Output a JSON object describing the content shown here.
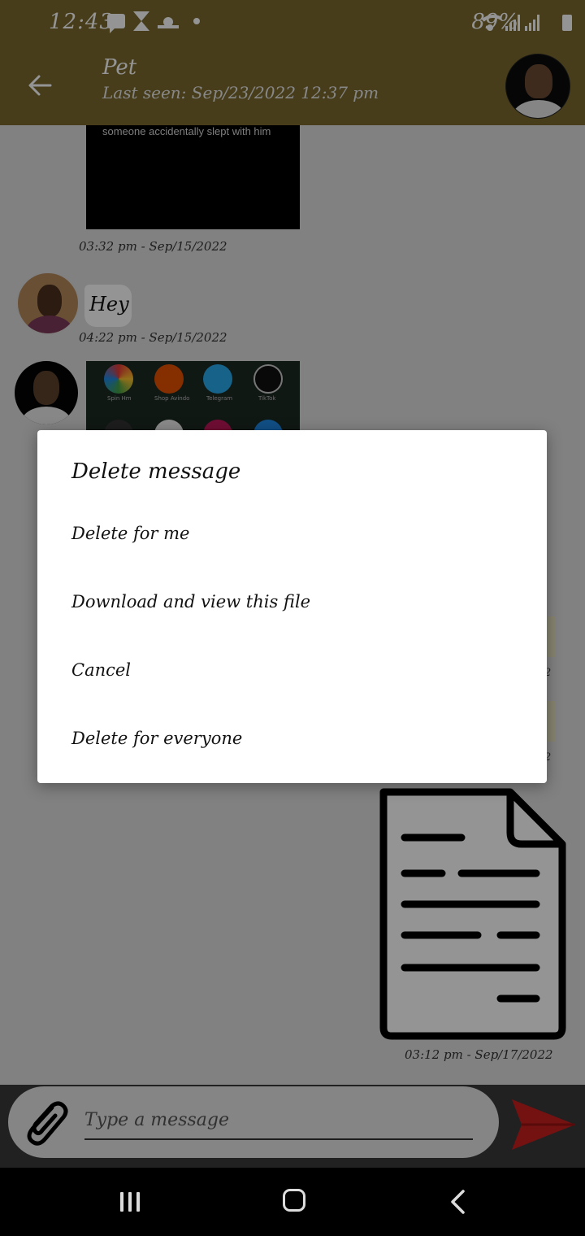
{
  "status_bar": {
    "time": "12:43",
    "battery": "89%"
  },
  "app_bar": {
    "contact_name": "Pet",
    "last_seen": "Last seen: Sep/23/2022 12:37 pm"
  },
  "messages": {
    "video_caption": "someone accidentally slept with him",
    "ts1": "03:32 pm - Sep/15/2022",
    "hey_text": "Hey",
    "ts2": "04:22 pm - Sep/15/2022",
    "apps": [
      "Spin Hm",
      "Shop Avindo",
      "Telegram",
      "TikTok"
    ],
    "ts_right_partial_1": "2",
    "ts_right_partial_2": "2",
    "ts3": "03:12 pm - Sep/17/2022"
  },
  "composer": {
    "placeholder": "Type a message"
  },
  "dialog": {
    "title": "Delete message",
    "options": [
      "Delete for me",
      "Download and view this file",
      "Cancel",
      "Delete for everyone"
    ]
  },
  "colors": {
    "app_bar": "#7a6a30",
    "send_arrow": "#c81e1e",
    "dialog_bg": "#ffffff"
  }
}
